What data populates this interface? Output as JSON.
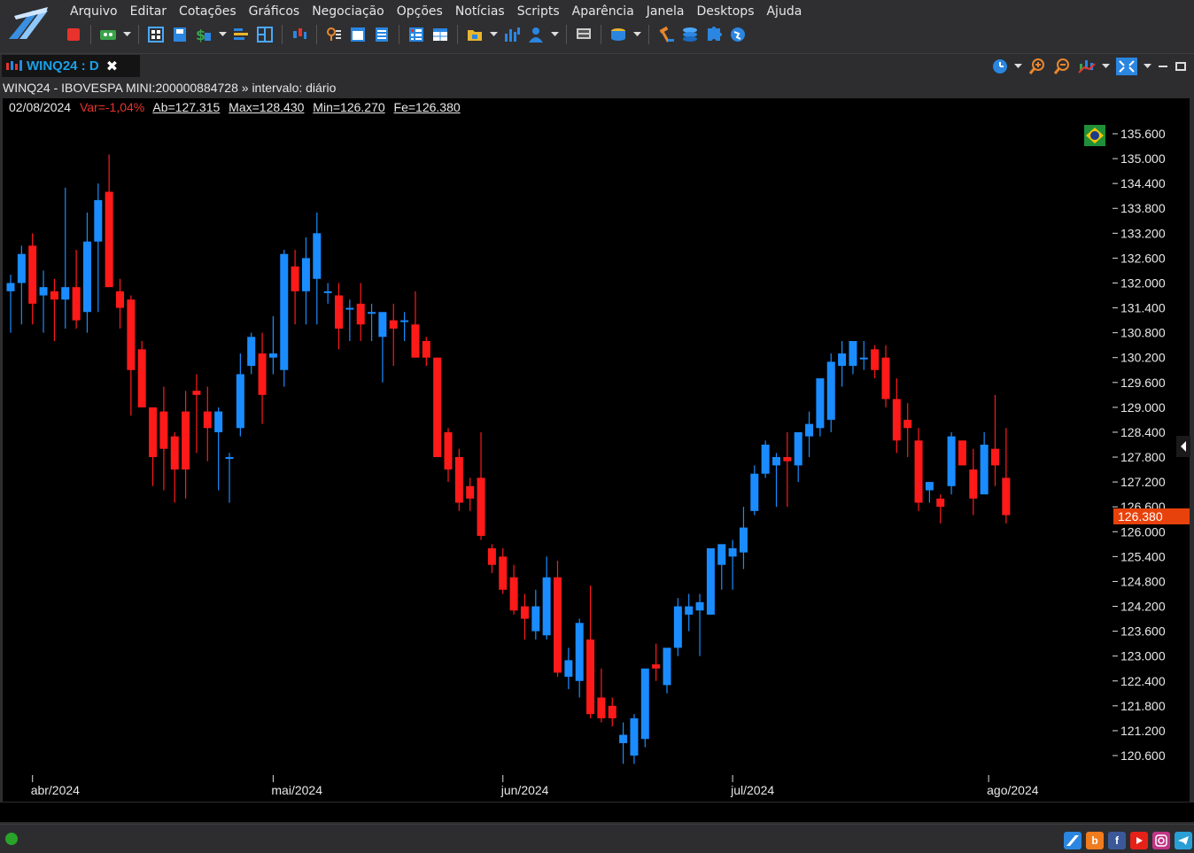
{
  "menu": [
    "Arquivo",
    "Editar",
    "Cotações",
    "Gráficos",
    "Negociação",
    "Opções",
    "Notícias",
    "Scripts",
    "Aparência",
    "Janela",
    "Desktops",
    "Ajuda"
  ],
  "tab": {
    "label": "WINQ24 : D",
    "close": "✖"
  },
  "info": {
    "title": "WINQ24 - IBOVESPA MINI:200000884728 » intervalo: diário"
  },
  "quote": {
    "date": "02/08/2024",
    "var": "Var=-1,04%",
    "open": "Ab=127.315",
    "max": "Max=128.430",
    "min": "Min=126.270",
    "close": "Fe=126.380"
  },
  "colors": {
    "up": "#1a8cff",
    "down": "#ff1a1a",
    "price_tag": "#e8420c",
    "background": "#000000"
  },
  "icons": [
    "stop-icon",
    "config-icon",
    "layout-icon",
    "save-icon",
    "money-icon",
    "bars-icon",
    "grid-icon",
    "candles-icon",
    "search-icon",
    "window-icon",
    "list-icon",
    "table-icon",
    "table2-icon",
    "folder-icon",
    "chart-icon",
    "user-icon",
    "monitor-icon",
    "database-icon",
    "stack-icon",
    "puzzle-icon",
    "globe-icon"
  ],
  "chart_data": {
    "type": "candlestick",
    "instrument": "WINQ24",
    "x_labels": [
      "abr/2024",
      "mai/2024",
      "jun/2024",
      "jul/2024",
      "ago/2024"
    ],
    "y_ticks": [
      "135.600",
      "135.000",
      "134.400",
      "133.800",
      "133.200",
      "132.600",
      "132.000",
      "131.400",
      "130.800",
      "130.200",
      "129.600",
      "129.000",
      "128.400",
      "127.800",
      "127.200",
      "126.600",
      "126.000",
      "125.400",
      "124.800",
      "124.200",
      "123.600",
      "123.000",
      "122.400",
      "121.800",
      "121.200",
      "120.600"
    ],
    "last_price": "126.380",
    "candles": [
      [
        131.8,
        132.2,
        130.8,
        132.0
      ],
      [
        132.0,
        132.9,
        131.0,
        132.7
      ],
      [
        132.9,
        133.2,
        131.0,
        131.5
      ],
      [
        131.7,
        132.3,
        130.8,
        131.9
      ],
      [
        131.8,
        132.1,
        130.6,
        131.6
      ],
      [
        131.6,
        134.3,
        130.9,
        131.9
      ],
      [
        131.9,
        132.8,
        130.9,
        131.1
      ],
      [
        131.3,
        133.7,
        130.8,
        133.0
      ],
      [
        133.0,
        134.4,
        131.3,
        134.0
      ],
      [
        134.2,
        135.1,
        131.9,
        131.9
      ],
      [
        131.8,
        132.1,
        130.9,
        131.4
      ],
      [
        131.6,
        131.7,
        128.8,
        129.9
      ],
      [
        130.4,
        130.6,
        129.0,
        129.0
      ],
      [
        129.0,
        129.0,
        127.1,
        127.8
      ],
      [
        128.9,
        129.5,
        127.0,
        128.0
      ],
      [
        128.3,
        128.4,
        126.7,
        127.5
      ],
      [
        128.9,
        129.4,
        126.8,
        127.5
      ],
      [
        129.4,
        129.8,
        127.9,
        129.3
      ],
      [
        128.9,
        129.5,
        127.7,
        128.5
      ],
      [
        128.4,
        129.0,
        127.0,
        128.9
      ],
      [
        127.8,
        127.9,
        126.7,
        127.8
      ],
      [
        128.5,
        130.3,
        128.3,
        129.8
      ],
      [
        130.0,
        130.8,
        129.8,
        130.7
      ],
      [
        130.3,
        130.8,
        128.6,
        129.3
      ],
      [
        130.2,
        131.2,
        129.8,
        130.3
      ],
      [
        129.9,
        132.8,
        129.5,
        132.7
      ],
      [
        132.4,
        132.8,
        131.0,
        131.8
      ],
      [
        131.8,
        133.1,
        131.0,
        132.6
      ],
      [
        132.1,
        133.7,
        131.0,
        133.2
      ],
      [
        131.8,
        132.0,
        131.5,
        131.8
      ],
      [
        131.7,
        132.0,
        130.4,
        130.9
      ],
      [
        131.4,
        131.6,
        130.6,
        131.4
      ],
      [
        131.5,
        132.0,
        130.6,
        131.0
      ],
      [
        131.3,
        131.5,
        130.6,
        131.3
      ],
      [
        130.7,
        131.0,
        129.6,
        131.3
      ],
      [
        131.1,
        131.5,
        130.0,
        130.9
      ],
      [
        131.1,
        131.3,
        130.6,
        131.1
      ],
      [
        131.0,
        131.8,
        130.3,
        130.2
      ],
      [
        130.6,
        130.7,
        130.0,
        130.2
      ],
      [
        130.2,
        130.2,
        127.8,
        127.8
      ],
      [
        128.4,
        128.5,
        127.2,
        127.5
      ],
      [
        127.8,
        128.0,
        126.5,
        126.7
      ],
      [
        127.1,
        127.3,
        126.5,
        126.8
      ],
      [
        127.3,
        128.4,
        125.8,
        125.9
      ],
      [
        125.6,
        125.7,
        125.0,
        125.2
      ],
      [
        125.4,
        125.6,
        124.5,
        124.6
      ],
      [
        124.9,
        125.2,
        124.0,
        124.1
      ],
      [
        124.2,
        124.5,
        123.4,
        123.9
      ],
      [
        123.6,
        124.6,
        123.4,
        124.2
      ],
      [
        123.5,
        125.4,
        123.4,
        124.9
      ],
      [
        124.9,
        125.3,
        122.5,
        122.6
      ],
      [
        122.5,
        123.2,
        122.2,
        122.9
      ],
      [
        122.4,
        123.9,
        122.0,
        123.8
      ],
      [
        123.4,
        124.7,
        121.5,
        121.6
      ],
      [
        122.0,
        122.7,
        121.4,
        121.5
      ],
      [
        121.8,
        122.0,
        121.3,
        121.5
      ],
      [
        120.9,
        121.4,
        120.4,
        121.1
      ],
      [
        120.6,
        121.6,
        120.4,
        121.5
      ],
      [
        121.0,
        122.5,
        120.8,
        122.7
      ],
      [
        122.8,
        123.3,
        122.4,
        122.7
      ],
      [
        122.3,
        123.1,
        122.1,
        123.2
      ],
      [
        123.2,
        124.4,
        123.0,
        124.2
      ],
      [
        124.0,
        124.5,
        123.6,
        124.2
      ],
      [
        124.1,
        124.5,
        123.0,
        124.3
      ],
      [
        124.0,
        125.6,
        124.0,
        125.6
      ],
      [
        125.2,
        125.5,
        124.6,
        125.7
      ],
      [
        125.4,
        125.8,
        124.6,
        125.6
      ],
      [
        125.5,
        126.6,
        125.1,
        126.1
      ],
      [
        126.5,
        127.6,
        126.4,
        127.4
      ],
      [
        127.4,
        128.2,
        127.3,
        128.1
      ],
      [
        127.6,
        127.9,
        126.6,
        127.8
      ],
      [
        127.8,
        128.4,
        126.6,
        127.7
      ],
      [
        127.6,
        128.4,
        127.2,
        128.4
      ],
      [
        128.3,
        128.9,
        127.8,
        128.6
      ],
      [
        128.5,
        129.1,
        128.3,
        129.7
      ],
      [
        128.7,
        130.3,
        128.4,
        130.1
      ],
      [
        130.0,
        130.6,
        129.5,
        130.3
      ],
      [
        130.0,
        130.6,
        129.8,
        130.6
      ],
      [
        130.2,
        130.6,
        129.9,
        130.2
      ],
      [
        130.4,
        130.5,
        129.7,
        129.9
      ],
      [
        130.2,
        130.5,
        129.0,
        129.2
      ],
      [
        129.2,
        129.7,
        127.9,
        128.2
      ],
      [
        128.7,
        129.1,
        127.8,
        128.5
      ],
      [
        128.2,
        128.5,
        126.5,
        126.7
      ],
      [
        127.0,
        127.2,
        126.7,
        127.2
      ],
      [
        126.8,
        126.9,
        126.2,
        126.6
      ],
      [
        127.1,
        128.4,
        126.9,
        128.3
      ],
      [
        128.2,
        128.2,
        127.6,
        127.6
      ],
      [
        127.5,
        128.0,
        126.4,
        126.8
      ],
      [
        126.9,
        128.4,
        127.0,
        128.1
      ],
      [
        128.0,
        129.3,
        127.1,
        127.6
      ],
      [
        127.3,
        128.5,
        126.2,
        126.4
      ]
    ]
  }
}
